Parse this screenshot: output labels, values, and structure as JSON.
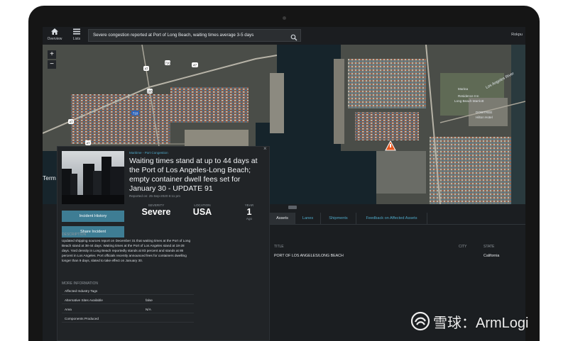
{
  "nav": {
    "overview_label": "Overview",
    "lists_label": "Lists"
  },
  "search": {
    "value": "Severe congestion reported at Port of Long Beach, waiting times average 3-5 days"
  },
  "user": {
    "name": "Rokpu"
  },
  "map": {
    "zoom_in": "+",
    "zoom_out": "−",
    "labels": {
      "la_river": "Los Angeles River",
      "terminal": "Term",
      "marina": "Marina",
      "residence_inn": "Residence Inn",
      "marriott": "Long Beach Marriott",
      "dowtree": "DOWTREE",
      "hilton": "Hilton Hotel"
    },
    "route_shields": [
      "47",
      "710",
      "103",
      "47",
      "710",
      "47",
      "47"
    ]
  },
  "card": {
    "category": "Maritime - Port Congestion",
    "title": "Waiting times stand at up to 44 days at the Port of Los Angeles-Long Beach; empty container dwell fees set for January 30 - UPDATE 91",
    "reported": "Reported on: 25-Sep-2020 6:11 pm",
    "close": "×",
    "history_button": "Incident History",
    "share_button": "Share Incident",
    "severity_label": "SEVERITY",
    "severity_value": "Severe",
    "location_label": "LOCATION",
    "location_value": "USA",
    "year_label": "YEAR",
    "year_value": "1",
    "year_sub": "Ago",
    "description_label": "DESCRIPTION",
    "description": "Updated shipping sources report on December 31 that waiting times at the Port of Long Beach stand at 38-44 days. Waiting times at the Port of Los Angeles stand at 18-28 days. Yard density in Long Beach reportedly stands at 83 percent and stands at 86 percent in Los Angeles. Port officials recently announced fees for containers dwelling longer than 9 days, slated to take effect on January 30.",
    "more_label": "MORE INFORMATION",
    "info": [
      {
        "key": "Affected Industry Tags",
        "value": ""
      },
      {
        "key": "Alternative Sites Available",
        "value": "false"
      },
      {
        "key": "Area",
        "value": "N/A"
      },
      {
        "key": "Components Produced",
        "value": ""
      }
    ]
  },
  "tabs": [
    {
      "label": "Assets",
      "active": true
    },
    {
      "label": "Lanes",
      "active": false
    },
    {
      "label": "Shipments",
      "active": false
    },
    {
      "label": "Feedback on Affected Assets",
      "active": false
    }
  ],
  "assets_table": {
    "headers": {
      "title": "TITLE",
      "city": "CITY",
      "state": "STATE"
    },
    "rows": [
      {
        "title": "PORT OF LOS ANGELES/LONG BEACH",
        "city": "",
        "state": "California"
      }
    ]
  },
  "watermark": {
    "text": "雪球：ArmLogi"
  },
  "colors": {
    "accent": "#4fa9c9",
    "button": "#3e7d94",
    "alert": "#e8571f"
  }
}
